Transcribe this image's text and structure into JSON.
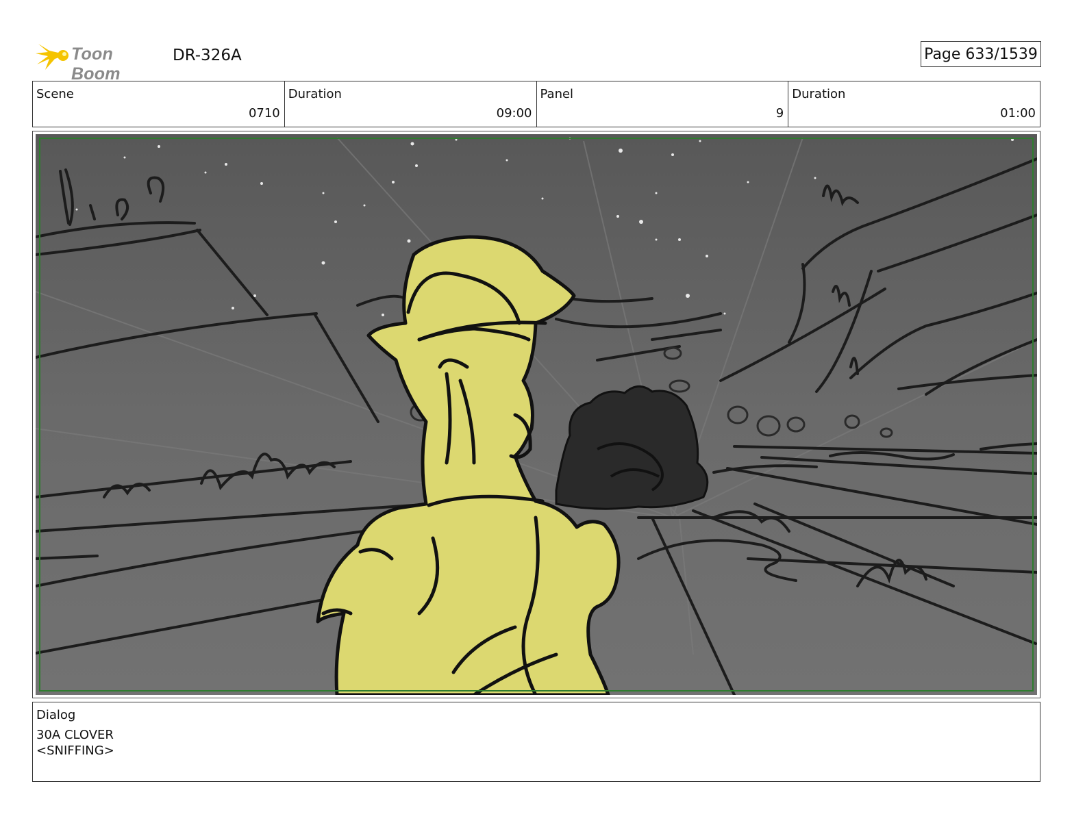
{
  "header": {
    "logo_text": "Toon Boom",
    "doc_id": "DR-326A",
    "page": "Page  633/1539"
  },
  "info": {
    "scene_label": "Scene",
    "scene_value": "0710",
    "duration_label": "Duration",
    "duration_value": "09:00",
    "panel_label": "Panel",
    "panel_value": "9",
    "panel_duration_label": "Duration",
    "panel_duration_value": "01:00"
  },
  "dialog": {
    "label": "Dialog",
    "line1": "30A CLOVER",
    "line2": "<SNIFFING>"
  },
  "colors": {
    "logo_accent": "#f5c400",
    "sky": "#5f5f5f",
    "ground": "#6b6b6b",
    "character_fill": "#dcd870",
    "safe_frame": "#2e7d2e"
  }
}
